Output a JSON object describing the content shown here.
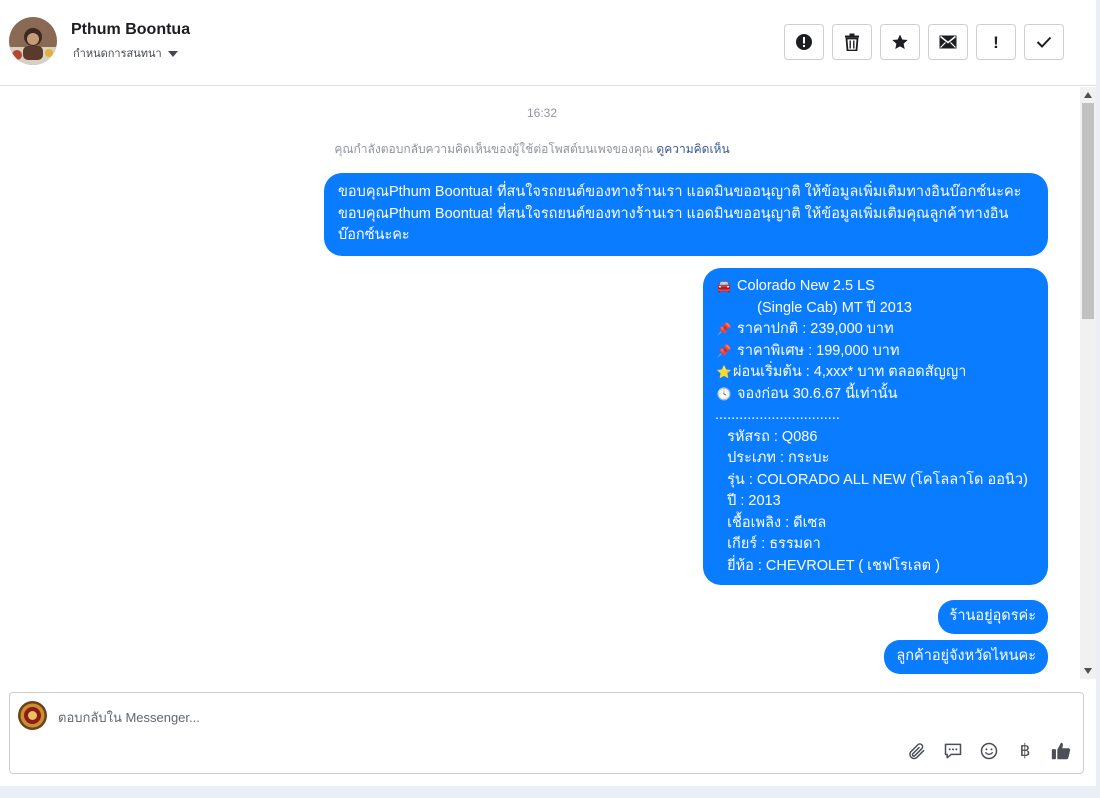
{
  "header": {
    "name": "Pthum Boontua",
    "assign_label": "กำหนดการสนทนา",
    "actions": [
      {
        "name": "spam-button",
        "icon": "alert-circle-icon"
      },
      {
        "name": "delete-button",
        "icon": "trash-icon"
      },
      {
        "name": "star-button",
        "icon": "star-icon"
      },
      {
        "name": "mark-unread-button",
        "icon": "envelope-icon"
      },
      {
        "name": "follow-up-button",
        "icon": "exclamation-icon",
        "glyph": "!"
      },
      {
        "name": "mark-done-button",
        "icon": "check-icon"
      }
    ]
  },
  "conversation": {
    "timestamp": "16:32",
    "notice_text": "คุณกำลังตอบกลับความคิดเห็นของผู้ใช้ต่อโพสต์บนเพจของคุณ",
    "notice_link": "ดูความคิดเห็น",
    "messages": {
      "m1": "ขอบคุณPthum Boontua! ที่สนใจรถยนต์ของทางร้านเรา แอดมินขออนุญาติ ให้ข้อมูลเพิ่มเติมทางอินบ๊อกซ์นะคะขอบคุณPthum Boontua! ที่สนใจรถยนต์ของทางร้านเรา แอดมินขออนุญาติ ให้ข้อมูลเพิ่มเติมคุณลูกค้าทางอินบ๊อกซ์นะคะ",
      "m2_lines": [
        {
          "emoji": "🚘",
          "text": " Colorado New 2.5 LS"
        },
        {
          "emoji": "",
          "text": "      (Single Cab) MT ปี 2013"
        },
        {
          "emoji": "📌",
          "text": " ราคาปกติ : 239,000 บาท"
        },
        {
          "emoji": "📌",
          "text": " ราคาพิเศษ : 199,000 บาท"
        },
        {
          "emoji": "⭐",
          "text": "ผ่อนเริ่มต้น : 4,xxx* บาท ตลอดสัญญา"
        },
        {
          "emoji": "🕓",
          "text": " จองก่อน 30.6.67 นี้เท่านั้น"
        },
        {
          "emoji": "",
          "text": "..............................."
        },
        {
          "emoji": "",
          "text": "   รหัสรถ : Q086"
        },
        {
          "emoji": "",
          "text": "   ประเภท : กระบะ"
        },
        {
          "emoji": "",
          "text": "   รุ่น : COLORADO ALL NEW (โคโลลาโด ออนิว)"
        },
        {
          "emoji": "",
          "text": "   ปี : 2013"
        },
        {
          "emoji": "",
          "text": "   เชื้อเพลิง : ดีเซล"
        },
        {
          "emoji": "",
          "text": "   เกียร์ : ธรรมดา"
        },
        {
          "emoji": "",
          "text": "   ยี่ห้อ : CHEVROLET ( เชฟโรเลต )"
        }
      ],
      "m3": "ร้านอยู่อุดรค่ะ",
      "m4": "ลูกค้าอยู่จังหวัดไหนคะ"
    }
  },
  "composer": {
    "placeholder": "ตอบกลับใน Messenger...",
    "tools": [
      "paperclip-icon",
      "chat-bubble-icon",
      "smiley-icon",
      "baht-icon",
      "thumbs-up-icon"
    ],
    "baht_glyph": "฿"
  },
  "colors": {
    "bubble": "#0a7cff",
    "link": "#385898",
    "muted": "#90949c"
  }
}
